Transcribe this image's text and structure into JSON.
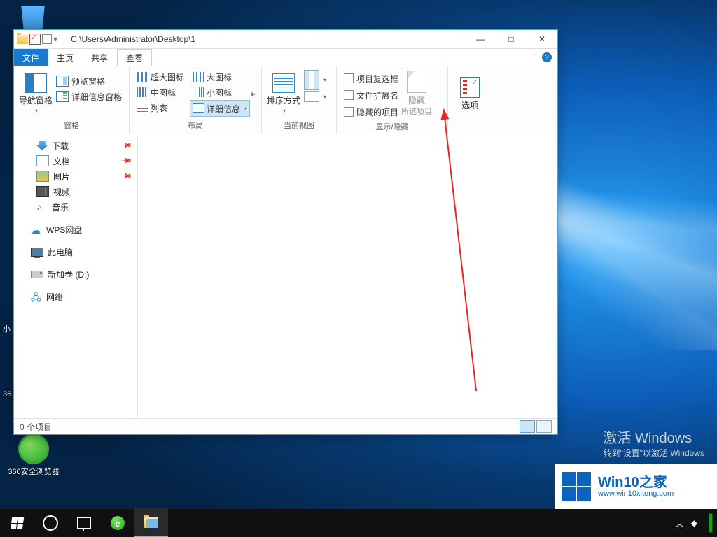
{
  "desktop": {
    "icons": {
      "recycle_top": "",
      "browser360": "360安全浏览器",
      "label_small1": "小",
      "label_small2": "36"
    },
    "activate": {
      "line1": "激活 Windows",
      "line2": "转到\"设置\"以激活 Windows"
    },
    "watermark": {
      "title": "Win10之家",
      "url": "www.win10xitong.com"
    }
  },
  "window": {
    "path": "C:\\Users\\Administrator\\Desktop\\1",
    "controls": {
      "min": "—",
      "max": "□",
      "close": "✕",
      "expand": "ˇ",
      "help": "?"
    },
    "tabs": {
      "file": "文件",
      "home": "主页",
      "share": "共享",
      "view": "查看"
    },
    "ribbon": {
      "panes": {
        "nav": "导航窗格",
        "preview": "预览窗格",
        "details": "详细信息窗格",
        "caption": "窗格"
      },
      "layout": {
        "xl": "超大图标",
        "l": "大图标",
        "m": "中图标",
        "s": "小图标",
        "list": "列表",
        "det": "详细信息",
        "caption": "布局"
      },
      "currentview": {
        "sort": "排序方式",
        "addcol": "",
        "fit": "",
        "caption": "当前视图"
      },
      "showhide": {
        "chk_item": "项目复选框",
        "chk_ext": "文件扩展名",
        "chk_hidden": "隐藏的项目",
        "hide": "隐藏",
        "hide2": "所选项目",
        "caption": "显示/隐藏"
      },
      "options": {
        "label": "选项"
      }
    },
    "sidebar": [
      {
        "key": "downloads",
        "label": "下载",
        "pin": true
      },
      {
        "key": "documents",
        "label": "文档",
        "pin": true
      },
      {
        "key": "pictures",
        "label": "图片",
        "pin": true
      },
      {
        "key": "videos",
        "label": "视频"
      },
      {
        "key": "music",
        "label": "音乐"
      },
      {
        "key": "wps",
        "label": "WPS网盘"
      },
      {
        "key": "thispc",
        "label": "此电脑"
      },
      {
        "key": "drive_d",
        "label": "新加卷 (D:)"
      },
      {
        "key": "network",
        "label": "网络"
      }
    ],
    "status": {
      "count": "0 个项目"
    }
  },
  "taskbar": {
    "tray": {
      "up": "︿",
      "noti": "◆"
    }
  }
}
